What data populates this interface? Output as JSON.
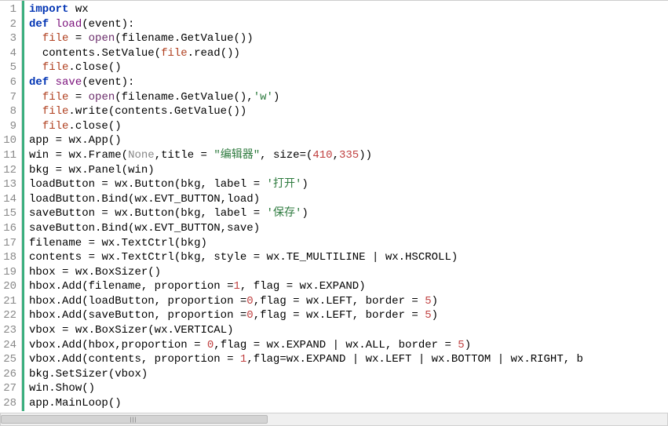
{
  "chart_data": null,
  "line_count": 28,
  "tokens": {
    "l1": [
      [
        "kw",
        "import"
      ],
      [
        "sp",
        " "
      ],
      [
        "name",
        "wx"
      ]
    ],
    "l2": [
      [
        "kw",
        "def"
      ],
      [
        "sp",
        " "
      ],
      [
        "fn",
        "load"
      ],
      [
        "op",
        "("
      ],
      [
        "name",
        "event"
      ],
      [
        "op",
        "):"
      ]
    ],
    "l3": [
      [
        "sp",
        "  "
      ],
      [
        "var",
        "file"
      ],
      [
        "sp",
        " "
      ],
      [
        "op",
        "="
      ],
      [
        "sp",
        " "
      ],
      [
        "builtin",
        "open"
      ],
      [
        "op",
        "("
      ],
      [
        "name",
        "filename"
      ],
      [
        "op",
        "."
      ],
      [
        "name",
        "GetValue"
      ],
      [
        "op",
        "())"
      ]
    ],
    "l4": [
      [
        "sp",
        "  "
      ],
      [
        "name",
        "contents"
      ],
      [
        "op",
        "."
      ],
      [
        "name",
        "SetValue"
      ],
      [
        "op",
        "("
      ],
      [
        "var",
        "file"
      ],
      [
        "op",
        "."
      ],
      [
        "name",
        "read"
      ],
      [
        "op",
        "())"
      ]
    ],
    "l5": [
      [
        "sp",
        "  "
      ],
      [
        "var",
        "file"
      ],
      [
        "op",
        "."
      ],
      [
        "name",
        "close"
      ],
      [
        "op",
        "()"
      ]
    ],
    "l6": [
      [
        "kw",
        "def"
      ],
      [
        "sp",
        " "
      ],
      [
        "fn",
        "save"
      ],
      [
        "op",
        "("
      ],
      [
        "name",
        "event"
      ],
      [
        "op",
        "):"
      ]
    ],
    "l7": [
      [
        "sp",
        "  "
      ],
      [
        "var",
        "file"
      ],
      [
        "sp",
        " "
      ],
      [
        "op",
        "="
      ],
      [
        "sp",
        " "
      ],
      [
        "builtin",
        "open"
      ],
      [
        "op",
        "("
      ],
      [
        "name",
        "filename"
      ],
      [
        "op",
        "."
      ],
      [
        "name",
        "GetValue"
      ],
      [
        "op",
        "(),"
      ],
      [
        "str",
        "'w'"
      ],
      [
        "op",
        ")"
      ]
    ],
    "l8": [
      [
        "sp",
        "  "
      ],
      [
        "var",
        "file"
      ],
      [
        "op",
        "."
      ],
      [
        "name",
        "write"
      ],
      [
        "op",
        "("
      ],
      [
        "name",
        "contents"
      ],
      [
        "op",
        "."
      ],
      [
        "name",
        "GetValue"
      ],
      [
        "op",
        "())"
      ]
    ],
    "l9": [
      [
        "sp",
        "  "
      ],
      [
        "var",
        "file"
      ],
      [
        "op",
        "."
      ],
      [
        "name",
        "close"
      ],
      [
        "op",
        "()"
      ]
    ],
    "l10": [
      [
        "name",
        "app"
      ],
      [
        "sp",
        " "
      ],
      [
        "op",
        "="
      ],
      [
        "sp",
        " "
      ],
      [
        "name",
        "wx"
      ],
      [
        "op",
        "."
      ],
      [
        "name",
        "App"
      ],
      [
        "op",
        "()"
      ]
    ],
    "l11": [
      [
        "name",
        "win"
      ],
      [
        "sp",
        " "
      ],
      [
        "op",
        "="
      ],
      [
        "sp",
        " "
      ],
      [
        "name",
        "wx"
      ],
      [
        "op",
        "."
      ],
      [
        "name",
        "Frame"
      ],
      [
        "op",
        "("
      ],
      [
        "none",
        "None"
      ],
      [
        "op",
        ","
      ],
      [
        "name",
        "title"
      ],
      [
        "sp",
        " "
      ],
      [
        "op",
        "="
      ],
      [
        "sp",
        " "
      ],
      [
        "str",
        "\"编辑器\""
      ],
      [
        "op",
        ", "
      ],
      [
        "name",
        "size"
      ],
      [
        "op",
        "=("
      ],
      [
        "num",
        "410"
      ],
      [
        "op",
        ","
      ],
      [
        "num",
        "335"
      ],
      [
        "op",
        "))"
      ]
    ],
    "l12": [
      [
        "name",
        "bkg"
      ],
      [
        "sp",
        " "
      ],
      [
        "op",
        "="
      ],
      [
        "sp",
        " "
      ],
      [
        "name",
        "wx"
      ],
      [
        "op",
        "."
      ],
      [
        "name",
        "Panel"
      ],
      [
        "op",
        "("
      ],
      [
        "name",
        "win"
      ],
      [
        "op",
        ")"
      ]
    ],
    "l13": [
      [
        "name",
        "loadButton"
      ],
      [
        "sp",
        " "
      ],
      [
        "op",
        "="
      ],
      [
        "sp",
        " "
      ],
      [
        "name",
        "wx"
      ],
      [
        "op",
        "."
      ],
      [
        "name",
        "Button"
      ],
      [
        "op",
        "("
      ],
      [
        "name",
        "bkg"
      ],
      [
        "op",
        ", "
      ],
      [
        "name",
        "label"
      ],
      [
        "sp",
        " "
      ],
      [
        "op",
        "="
      ],
      [
        "sp",
        " "
      ],
      [
        "str",
        "'打开'"
      ],
      [
        "op",
        ")"
      ]
    ],
    "l14": [
      [
        "name",
        "loadButton"
      ],
      [
        "op",
        "."
      ],
      [
        "name",
        "Bind"
      ],
      [
        "op",
        "("
      ],
      [
        "name",
        "wx"
      ],
      [
        "op",
        "."
      ],
      [
        "name",
        "EVT_BUTTON"
      ],
      [
        "op",
        ","
      ],
      [
        "name",
        "load"
      ],
      [
        "op",
        ")"
      ]
    ],
    "l15": [
      [
        "name",
        "saveButton"
      ],
      [
        "sp",
        " "
      ],
      [
        "op",
        "="
      ],
      [
        "sp",
        " "
      ],
      [
        "name",
        "wx"
      ],
      [
        "op",
        "."
      ],
      [
        "name",
        "Button"
      ],
      [
        "op",
        "("
      ],
      [
        "name",
        "bkg"
      ],
      [
        "op",
        ", "
      ],
      [
        "name",
        "label"
      ],
      [
        "sp",
        " "
      ],
      [
        "op",
        "="
      ],
      [
        "sp",
        " "
      ],
      [
        "str",
        "'保存'"
      ],
      [
        "op",
        ")"
      ]
    ],
    "l16": [
      [
        "name",
        "saveButton"
      ],
      [
        "op",
        "."
      ],
      [
        "name",
        "Bind"
      ],
      [
        "op",
        "("
      ],
      [
        "name",
        "wx"
      ],
      [
        "op",
        "."
      ],
      [
        "name",
        "EVT_BUTTON"
      ],
      [
        "op",
        ","
      ],
      [
        "name",
        "save"
      ],
      [
        "op",
        ")"
      ]
    ],
    "l17": [
      [
        "name",
        "filename"
      ],
      [
        "sp",
        " "
      ],
      [
        "op",
        "="
      ],
      [
        "sp",
        " "
      ],
      [
        "name",
        "wx"
      ],
      [
        "op",
        "."
      ],
      [
        "name",
        "TextCtrl"
      ],
      [
        "op",
        "("
      ],
      [
        "name",
        "bkg"
      ],
      [
        "op",
        ")"
      ]
    ],
    "l18": [
      [
        "name",
        "contents"
      ],
      [
        "sp",
        " "
      ],
      [
        "op",
        "="
      ],
      [
        "sp",
        " "
      ],
      [
        "name",
        "wx"
      ],
      [
        "op",
        "."
      ],
      [
        "name",
        "TextCtrl"
      ],
      [
        "op",
        "("
      ],
      [
        "name",
        "bkg"
      ],
      [
        "op",
        ", "
      ],
      [
        "name",
        "style"
      ],
      [
        "sp",
        " "
      ],
      [
        "op",
        "="
      ],
      [
        "sp",
        " "
      ],
      [
        "name",
        "wx"
      ],
      [
        "op",
        "."
      ],
      [
        "name",
        "TE_MULTILINE"
      ],
      [
        "sp",
        " "
      ],
      [
        "op",
        "|"
      ],
      [
        "sp",
        " "
      ],
      [
        "name",
        "wx"
      ],
      [
        "op",
        "."
      ],
      [
        "name",
        "HSCROLL"
      ],
      [
        "op",
        ")"
      ]
    ],
    "l19": [
      [
        "name",
        "hbox"
      ],
      [
        "sp",
        " "
      ],
      [
        "op",
        "="
      ],
      [
        "sp",
        " "
      ],
      [
        "name",
        "wx"
      ],
      [
        "op",
        "."
      ],
      [
        "name",
        "BoxSizer"
      ],
      [
        "op",
        "()"
      ]
    ],
    "l20": [
      [
        "name",
        "hbox"
      ],
      [
        "op",
        "."
      ],
      [
        "name",
        "Add"
      ],
      [
        "op",
        "("
      ],
      [
        "name",
        "filename"
      ],
      [
        "op",
        ", "
      ],
      [
        "name",
        "proportion"
      ],
      [
        "sp",
        " "
      ],
      [
        "op",
        "="
      ],
      [
        "num",
        "1"
      ],
      [
        "op",
        ", "
      ],
      [
        "name",
        "flag"
      ],
      [
        "sp",
        " "
      ],
      [
        "op",
        "="
      ],
      [
        "sp",
        " "
      ],
      [
        "name",
        "wx"
      ],
      [
        "op",
        "."
      ],
      [
        "name",
        "EXPAND"
      ],
      [
        "op",
        ")"
      ]
    ],
    "l21": [
      [
        "name",
        "hbox"
      ],
      [
        "op",
        "."
      ],
      [
        "name",
        "Add"
      ],
      [
        "op",
        "("
      ],
      [
        "name",
        "loadButton"
      ],
      [
        "op",
        ", "
      ],
      [
        "name",
        "proportion"
      ],
      [
        "sp",
        " "
      ],
      [
        "op",
        "="
      ],
      [
        "num",
        "0"
      ],
      [
        "op",
        ","
      ],
      [
        "name",
        "flag"
      ],
      [
        "sp",
        " "
      ],
      [
        "op",
        "="
      ],
      [
        "sp",
        " "
      ],
      [
        "name",
        "wx"
      ],
      [
        "op",
        "."
      ],
      [
        "name",
        "LEFT"
      ],
      [
        "op",
        ", "
      ],
      [
        "name",
        "border"
      ],
      [
        "sp",
        " "
      ],
      [
        "op",
        "="
      ],
      [
        "sp",
        " "
      ],
      [
        "num",
        "5"
      ],
      [
        "op",
        ")"
      ]
    ],
    "l22": [
      [
        "name",
        "hbox"
      ],
      [
        "op",
        "."
      ],
      [
        "name",
        "Add"
      ],
      [
        "op",
        "("
      ],
      [
        "name",
        "saveButton"
      ],
      [
        "op",
        ", "
      ],
      [
        "name",
        "proportion"
      ],
      [
        "sp",
        " "
      ],
      [
        "op",
        "="
      ],
      [
        "num",
        "0"
      ],
      [
        "op",
        ","
      ],
      [
        "name",
        "flag"
      ],
      [
        "sp",
        " "
      ],
      [
        "op",
        "="
      ],
      [
        "sp",
        " "
      ],
      [
        "name",
        "wx"
      ],
      [
        "op",
        "."
      ],
      [
        "name",
        "LEFT"
      ],
      [
        "op",
        ", "
      ],
      [
        "name",
        "border"
      ],
      [
        "sp",
        " "
      ],
      [
        "op",
        "="
      ],
      [
        "sp",
        " "
      ],
      [
        "num",
        "5"
      ],
      [
        "op",
        ")"
      ]
    ],
    "l23": [
      [
        "name",
        "vbox"
      ],
      [
        "sp",
        " "
      ],
      [
        "op",
        "="
      ],
      [
        "sp",
        " "
      ],
      [
        "name",
        "wx"
      ],
      [
        "op",
        "."
      ],
      [
        "name",
        "BoxSizer"
      ],
      [
        "op",
        "("
      ],
      [
        "name",
        "wx"
      ],
      [
        "op",
        "."
      ],
      [
        "name",
        "VERTICAL"
      ],
      [
        "op",
        ")"
      ]
    ],
    "l24": [
      [
        "name",
        "vbox"
      ],
      [
        "op",
        "."
      ],
      [
        "name",
        "Add"
      ],
      [
        "op",
        "("
      ],
      [
        "name",
        "hbox"
      ],
      [
        "op",
        ","
      ],
      [
        "name",
        "proportion"
      ],
      [
        "sp",
        " "
      ],
      [
        "op",
        "="
      ],
      [
        "sp",
        " "
      ],
      [
        "num",
        "0"
      ],
      [
        "op",
        ","
      ],
      [
        "name",
        "flag"
      ],
      [
        "sp",
        " "
      ],
      [
        "op",
        "="
      ],
      [
        "sp",
        " "
      ],
      [
        "name",
        "wx"
      ],
      [
        "op",
        "."
      ],
      [
        "name",
        "EXPAND"
      ],
      [
        "sp",
        " "
      ],
      [
        "op",
        "|"
      ],
      [
        "sp",
        " "
      ],
      [
        "name",
        "wx"
      ],
      [
        "op",
        "."
      ],
      [
        "name",
        "ALL"
      ],
      [
        "op",
        ", "
      ],
      [
        "name",
        "border"
      ],
      [
        "sp",
        " "
      ],
      [
        "op",
        "="
      ],
      [
        "sp",
        " "
      ],
      [
        "num",
        "5"
      ],
      [
        "op",
        ")"
      ]
    ],
    "l25": [
      [
        "name",
        "vbox"
      ],
      [
        "op",
        "."
      ],
      [
        "name",
        "Add"
      ],
      [
        "op",
        "("
      ],
      [
        "name",
        "contents"
      ],
      [
        "op",
        ", "
      ],
      [
        "name",
        "proportion"
      ],
      [
        "sp",
        " "
      ],
      [
        "op",
        "="
      ],
      [
        "sp",
        " "
      ],
      [
        "num",
        "1"
      ],
      [
        "op",
        ","
      ],
      [
        "name",
        "flag"
      ],
      [
        "op",
        "="
      ],
      [
        "name",
        "wx"
      ],
      [
        "op",
        "."
      ],
      [
        "name",
        "EXPAND"
      ],
      [
        "sp",
        " "
      ],
      [
        "op",
        "|"
      ],
      [
        "sp",
        " "
      ],
      [
        "name",
        "wx"
      ],
      [
        "op",
        "."
      ],
      [
        "name",
        "LEFT"
      ],
      [
        "sp",
        " "
      ],
      [
        "op",
        "|"
      ],
      [
        "sp",
        " "
      ],
      [
        "name",
        "wx"
      ],
      [
        "op",
        "."
      ],
      [
        "name",
        "BOTTOM"
      ],
      [
        "sp",
        " "
      ],
      [
        "op",
        "|"
      ],
      [
        "sp",
        " "
      ],
      [
        "name",
        "wx"
      ],
      [
        "op",
        "."
      ],
      [
        "name",
        "RIGHT"
      ],
      [
        "op",
        ", "
      ],
      [
        "name",
        "b"
      ]
    ],
    "l26": [
      [
        "name",
        "bkg"
      ],
      [
        "op",
        "."
      ],
      [
        "name",
        "SetSizer"
      ],
      [
        "op",
        "("
      ],
      [
        "name",
        "vbox"
      ],
      [
        "op",
        ")"
      ]
    ],
    "l27": [
      [
        "name",
        "win"
      ],
      [
        "op",
        "."
      ],
      [
        "name",
        "Show"
      ],
      [
        "op",
        "()"
      ]
    ],
    "l28": [
      [
        "name",
        "app"
      ],
      [
        "op",
        "."
      ],
      [
        "name",
        "MainLoop"
      ],
      [
        "op",
        "()"
      ]
    ]
  }
}
